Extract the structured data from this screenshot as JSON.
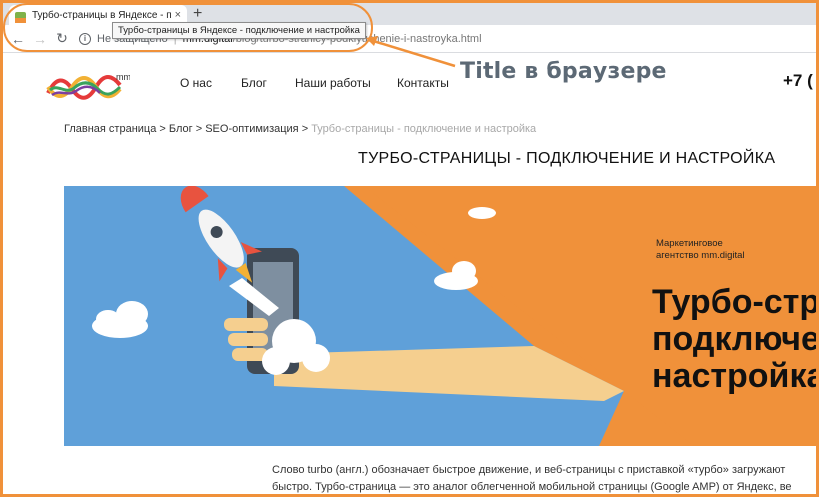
{
  "browser": {
    "tab_title": "Турбо-страницы в Яндексе - по",
    "tab_close": "×",
    "new_tab": "+",
    "tooltip": "Турбо-страницы в Яндексе - подключение и настройка",
    "security_label": "Не защищено",
    "url_host": "mm.digital",
    "url_path": "/blog/turbo-stranicy-podklyuchenie-i-nastroyka.html",
    "back_icon": "back-arrow-icon",
    "forward_icon": "forward-arrow-icon",
    "reload_icon": "reload-icon"
  },
  "annotation": {
    "label": "Title в браузере",
    "color": "#f0913a"
  },
  "site": {
    "logo_text": "mm",
    "nav": [
      "О нас",
      "Блог",
      "Наши работы",
      "Контакты"
    ],
    "phone": "+7 ("
  },
  "breadcrumb": {
    "items": [
      "Главная страница",
      "Блог",
      "SEO-оптимизация"
    ],
    "separator": ">",
    "current": "Турбо-страницы - подключение и настройка"
  },
  "page_title": "ТУРБО-СТРАНИЦЫ - ПОДКЛЮЧЕНИЕ И НАСТРОЙКА",
  "hero": {
    "agency_line1": "Маркетинговое",
    "agency_line2": "агентство mm.digital",
    "title_line1": "Турбо-стр",
    "title_line2": "подключе",
    "title_line3": "настройка",
    "colors": {
      "sky": "#5fa0d9",
      "orange": "#f0913a",
      "arm": "#f5cf8f"
    }
  },
  "body_text": {
    "line1": "Слово turbo (англ.) обозначает быстрое движение, и веб-страницы с приставкой «турбо» загружают",
    "line2": "быстро. Турбо-страница — это аналог облегченной мобильной страницы (Google AMP) от Яндекс, ве"
  }
}
